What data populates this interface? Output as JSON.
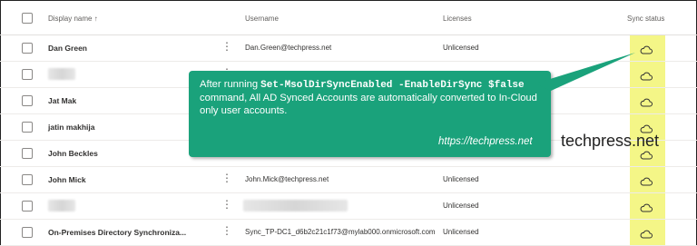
{
  "header": {
    "display_name": "Display name",
    "username": "Username",
    "licenses": "Licenses",
    "sync_status": "Sync status"
  },
  "rows": [
    {
      "name": "Dan Green",
      "username": "Dan.Green@techpress.net",
      "license": "Unlicensed",
      "name_blurred": false,
      "user_blurred": false
    },
    {
      "name": "",
      "username": "",
      "license": "Unlicensed",
      "name_blurred": true,
      "user_blurred": false
    },
    {
      "name": "Jat Mak",
      "username": "",
      "license": "",
      "name_blurred": false,
      "user_blurred": false
    },
    {
      "name": "jatin makhija",
      "username": "",
      "license": "",
      "name_blurred": false,
      "user_blurred": false
    },
    {
      "name": "John Beckles",
      "username": "",
      "license": "",
      "name_blurred": false,
      "user_blurred": false
    },
    {
      "name": "John Mick",
      "username": "John.Mick@techpress.net",
      "license": "Unlicensed",
      "name_blurred": false,
      "user_blurred": false
    },
    {
      "name": "",
      "username": "",
      "license": "Unlicensed",
      "name_blurred": true,
      "user_blurred": true
    },
    {
      "name": "On-Premises Directory Synchroniza...",
      "username": "Sync_TP-DC1_d6b2c21c1f73@mylab000.onmicrosoft.com",
      "license": "Unlicensed",
      "name_blurred": false,
      "user_blurred": false
    }
  ],
  "callout": {
    "line1_prefix": "After running ",
    "command": "Set-MsolDirSyncEnabled -EnableDirSync $false",
    "rest": " command, All AD Synced Accounts are automatically converted to In-Cloud only user accounts.",
    "url": "https://techpress.net"
  },
  "watermark": "techpress.net",
  "colors": {
    "highlight": "#f3f57a",
    "callout_bg": "#1aa27b"
  },
  "icons": {
    "sync": "cloud-icon",
    "more": "more-vertical-icon"
  }
}
